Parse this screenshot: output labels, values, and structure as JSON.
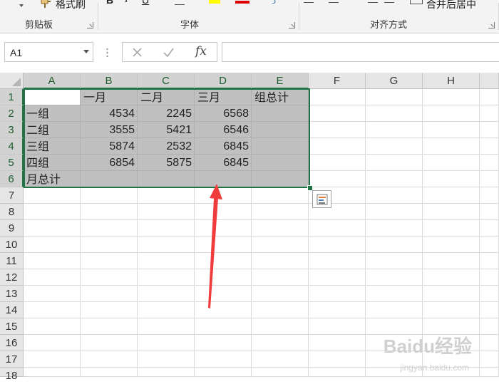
{
  "ribbon": {
    "format_painter_label": "格式刷",
    "merge_center_label": "合并后居中",
    "groups": {
      "clipboard": "剪贴板",
      "font": "字体",
      "alignment": "对齐方式"
    }
  },
  "formula_bar": {
    "name_box_value": "A1",
    "cancel_icon": "close-icon",
    "enter_icon": "check-icon",
    "fx_label": "fx",
    "formula_value": ""
  },
  "columns": [
    "A",
    "B",
    "C",
    "D",
    "E",
    "F",
    "G",
    "H"
  ],
  "rows": [
    "1",
    "2",
    "3",
    "4",
    "5",
    "6",
    "7",
    "8",
    "9",
    "10",
    "11",
    "12",
    "13",
    "14",
    "15",
    "16",
    "17",
    "18"
  ],
  "sheet": {
    "row1": [
      "",
      "一月",
      "二月",
      "三月",
      "组总计"
    ],
    "row2": [
      "一组",
      "4534",
      "2245",
      "6568",
      ""
    ],
    "row3": [
      "二组",
      "3555",
      "5421",
      "6546",
      ""
    ],
    "row4": [
      "三组",
      "5874",
      "2532",
      "6845",
      ""
    ],
    "row5": [
      "四组",
      "6854",
      "5875",
      "6845",
      ""
    ],
    "row6": [
      "月总计",
      "",
      "",
      "",
      ""
    ]
  },
  "colors": {
    "selection_border": "#217346",
    "selection_fill": "#c0c0c0",
    "annotation_arrow": "#f03c3c"
  },
  "watermark": {
    "text": "Baidu经验",
    "url_text": "jingyan.baidu.com"
  }
}
